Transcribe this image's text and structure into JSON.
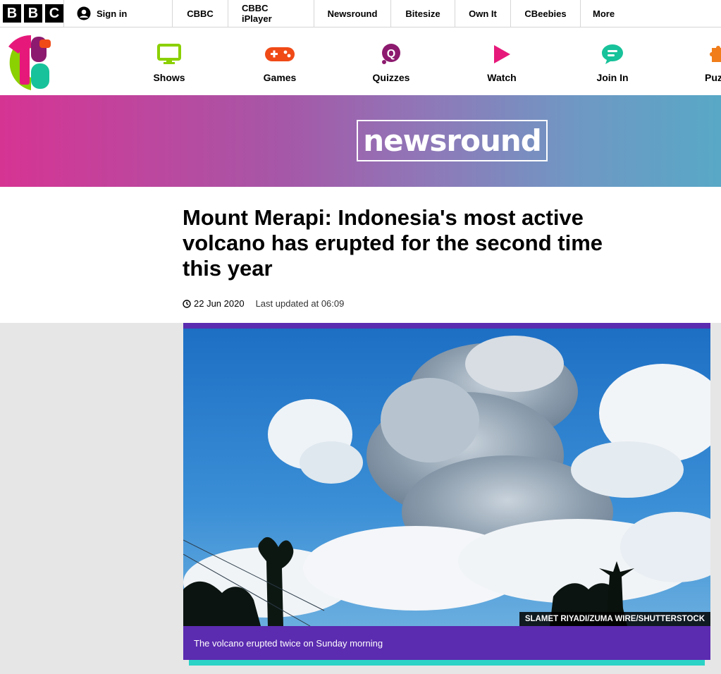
{
  "bbc_bar": {
    "logo_letters": [
      "B",
      "B",
      "C"
    ],
    "signin_label": "Sign in",
    "links": [
      "CBBC",
      "CBBC iPlayer",
      "Newsround",
      "Bitesize",
      "Own It",
      "CBeebies",
      "More"
    ]
  },
  "cbbc_nav": {
    "items": [
      {
        "label": "Shows",
        "icon": "tv-icon",
        "color": "#8bd000"
      },
      {
        "label": "Games",
        "icon": "gamepad-icon",
        "color": "#f04a17"
      },
      {
        "label": "Quizzes",
        "icon": "quiz-icon",
        "color": "#8c1a6e"
      },
      {
        "label": "Watch",
        "icon": "play-icon",
        "color": "#e6197a"
      },
      {
        "label": "Join In",
        "icon": "chat-icon",
        "color": "#18c29a"
      },
      {
        "label": "Puz",
        "icon": "puzzle-icon",
        "color": "#f07d1a"
      }
    ]
  },
  "banner": {
    "logo_text": "newsround"
  },
  "article": {
    "headline": "Mount Merapi: Indonesia's most active volcano has erupted for the second time this year",
    "date": "22 Jun 2020",
    "updated": "Last updated at 06:09",
    "image_credit": "SLAMET RIYADI/ZUMA WIRE/SHUTTERSTOCK",
    "caption": "The volcano erupted twice on Sunday morning"
  },
  "colors": {
    "caption_bg": "#5b2bb0",
    "accent_teal": "#2ad3c6"
  }
}
